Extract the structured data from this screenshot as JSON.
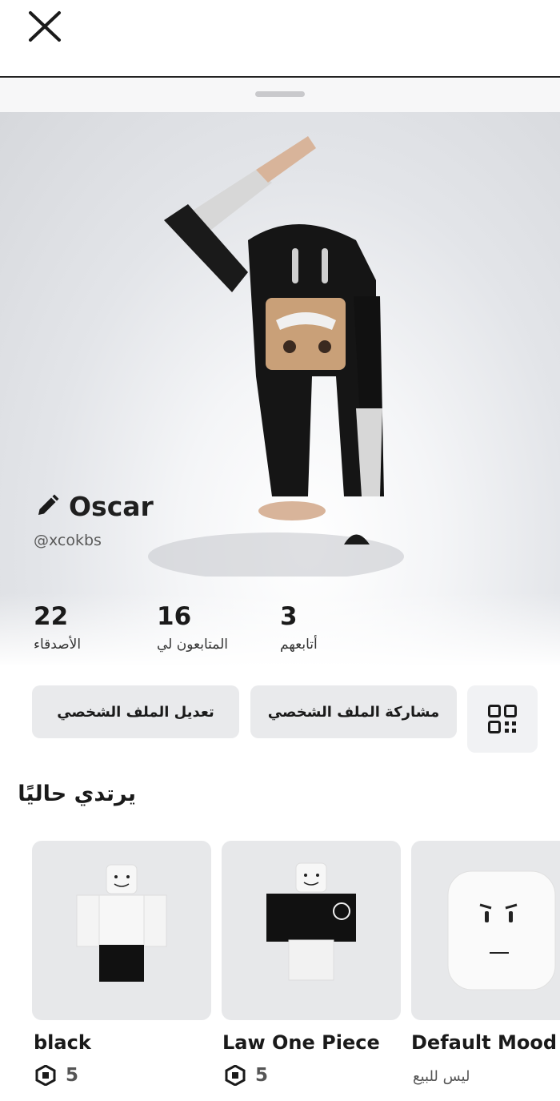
{
  "profile": {
    "display_name": "Oscar",
    "username": "@xcokbs"
  },
  "stats": [
    {
      "value": "22",
      "label": "الأصدقاء"
    },
    {
      "value": "16",
      "label": "المتابعون لي"
    },
    {
      "value": "3",
      "label": "أتابعهم"
    }
  ],
  "actions": {
    "edit_profile": "تعديل الملف الشخصي",
    "share_profile": "مشاركة الملف الشخصي"
  },
  "currently_wearing": {
    "title": "يرتدي حاليًا",
    "items": [
      {
        "name": "black",
        "price": "5"
      },
      {
        "name": "Law One Piece",
        "price": "5"
      },
      {
        "name": "Default Mood",
        "status": "ليس للبيع"
      }
    ]
  },
  "icons": {
    "close": "close-icon",
    "edit": "pencil-icon",
    "qr": "qr-code-icon",
    "currency": "robux-icon"
  },
  "colors": {
    "text": "#1a1a1a",
    "button_bg": "#e9eaec",
    "card_bg": "#e7e8ea"
  }
}
